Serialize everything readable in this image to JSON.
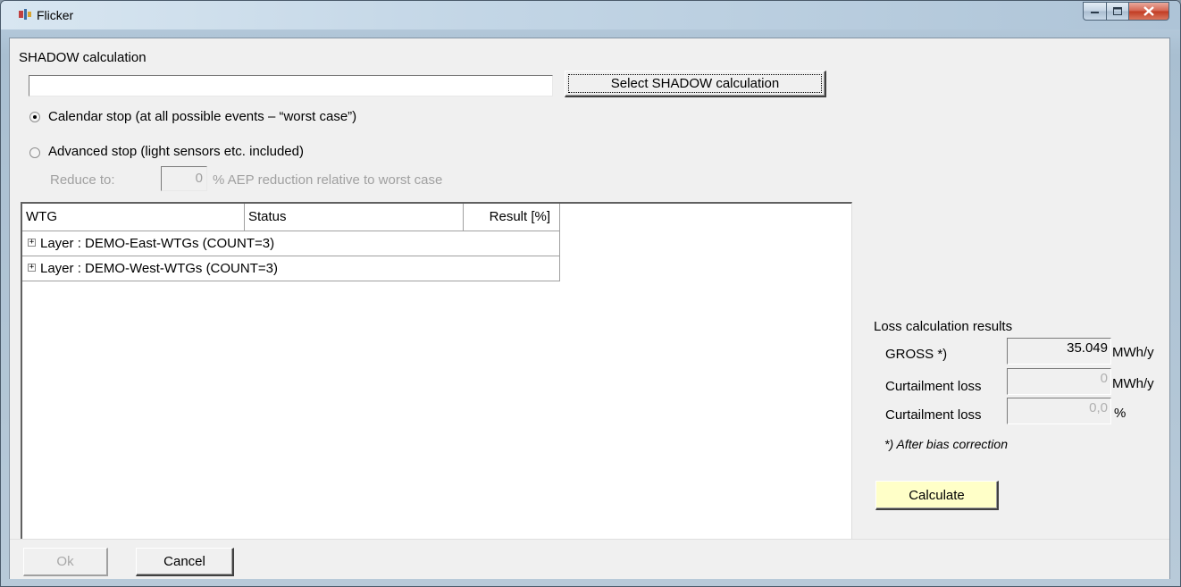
{
  "window": {
    "title": "Flicker"
  },
  "shadow": {
    "section_label": "SHADOW calculation",
    "path_value": "",
    "select_button": "Select SHADOW calculation"
  },
  "options": {
    "calendar_label": "Calendar stop (at all possible events – “worst case”)",
    "calendar_selected": true,
    "advanced_label": "Advanced stop (light sensors etc. included)",
    "advanced_selected": false,
    "reduce_label": "Reduce to:",
    "reduce_value": "0",
    "reduce_suffix": "% AEP reduction relative to worst case"
  },
  "tree": {
    "columns": [
      "WTG",
      "Status",
      "Result [%]"
    ],
    "rows": [
      {
        "expander": "+",
        "label": "Layer : DEMO-East-WTGs (COUNT=3)"
      },
      {
        "expander": "+",
        "label": "Layer : DEMO-West-WTGs (COUNT=3)"
      }
    ]
  },
  "results": {
    "title": "Loss calculation results",
    "gross_label": "GROSS *)",
    "gross_value": "35.049",
    "gross_unit": "MWh/y",
    "curtail_label": "Curtailment loss",
    "curtail_value": "0",
    "curtail_unit": "MWh/y",
    "curtail_pct_label": "Curtailment loss",
    "curtail_pct_value": "0,0",
    "curtail_pct_unit": "%",
    "note": "*) After bias correction",
    "calculate_button": "Calculate"
  },
  "footer": {
    "ok_button": "Ok",
    "cancel_button": "Cancel"
  },
  "colors": {
    "calculate_bg": "#ffffc8",
    "close_button": "#c9472f"
  }
}
